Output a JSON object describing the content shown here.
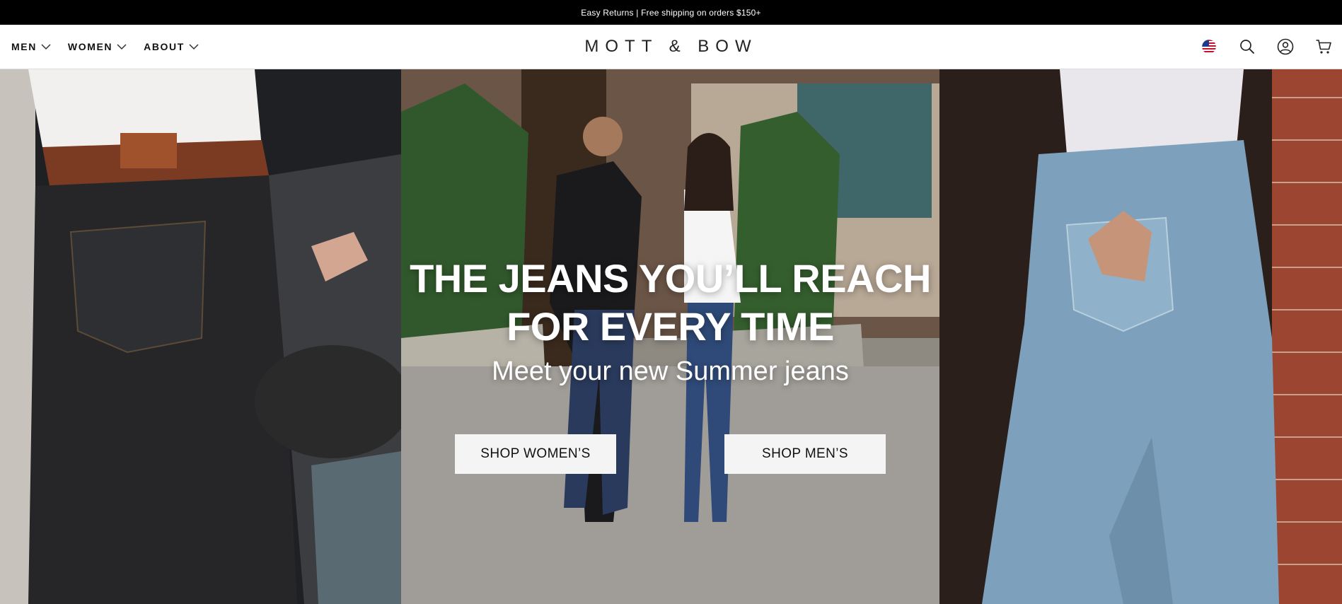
{
  "announcement": {
    "text": "Easy Returns | Free shipping on orders $150+"
  },
  "header": {
    "nav": [
      {
        "label": "MEN"
      },
      {
        "label": "WOMEN"
      },
      {
        "label": "ABOUT"
      }
    ],
    "logo": "MOTT & BOW",
    "icons": [
      "us-flag-icon",
      "search-icon",
      "account-icon",
      "cart-icon"
    ]
  },
  "hero": {
    "title": "THE JEANS YOU’LL REACH FOR EVERY TIME",
    "subtitle": "Meet your new Summer jeans",
    "buttons": {
      "women": "SHOP WOMEN’S",
      "men": "SHOP MEN’S"
    }
  },
  "colors": {
    "announcement_bg": "#000000",
    "header_bg": "#ffffff",
    "button_bg": "#f4f4f4"
  }
}
